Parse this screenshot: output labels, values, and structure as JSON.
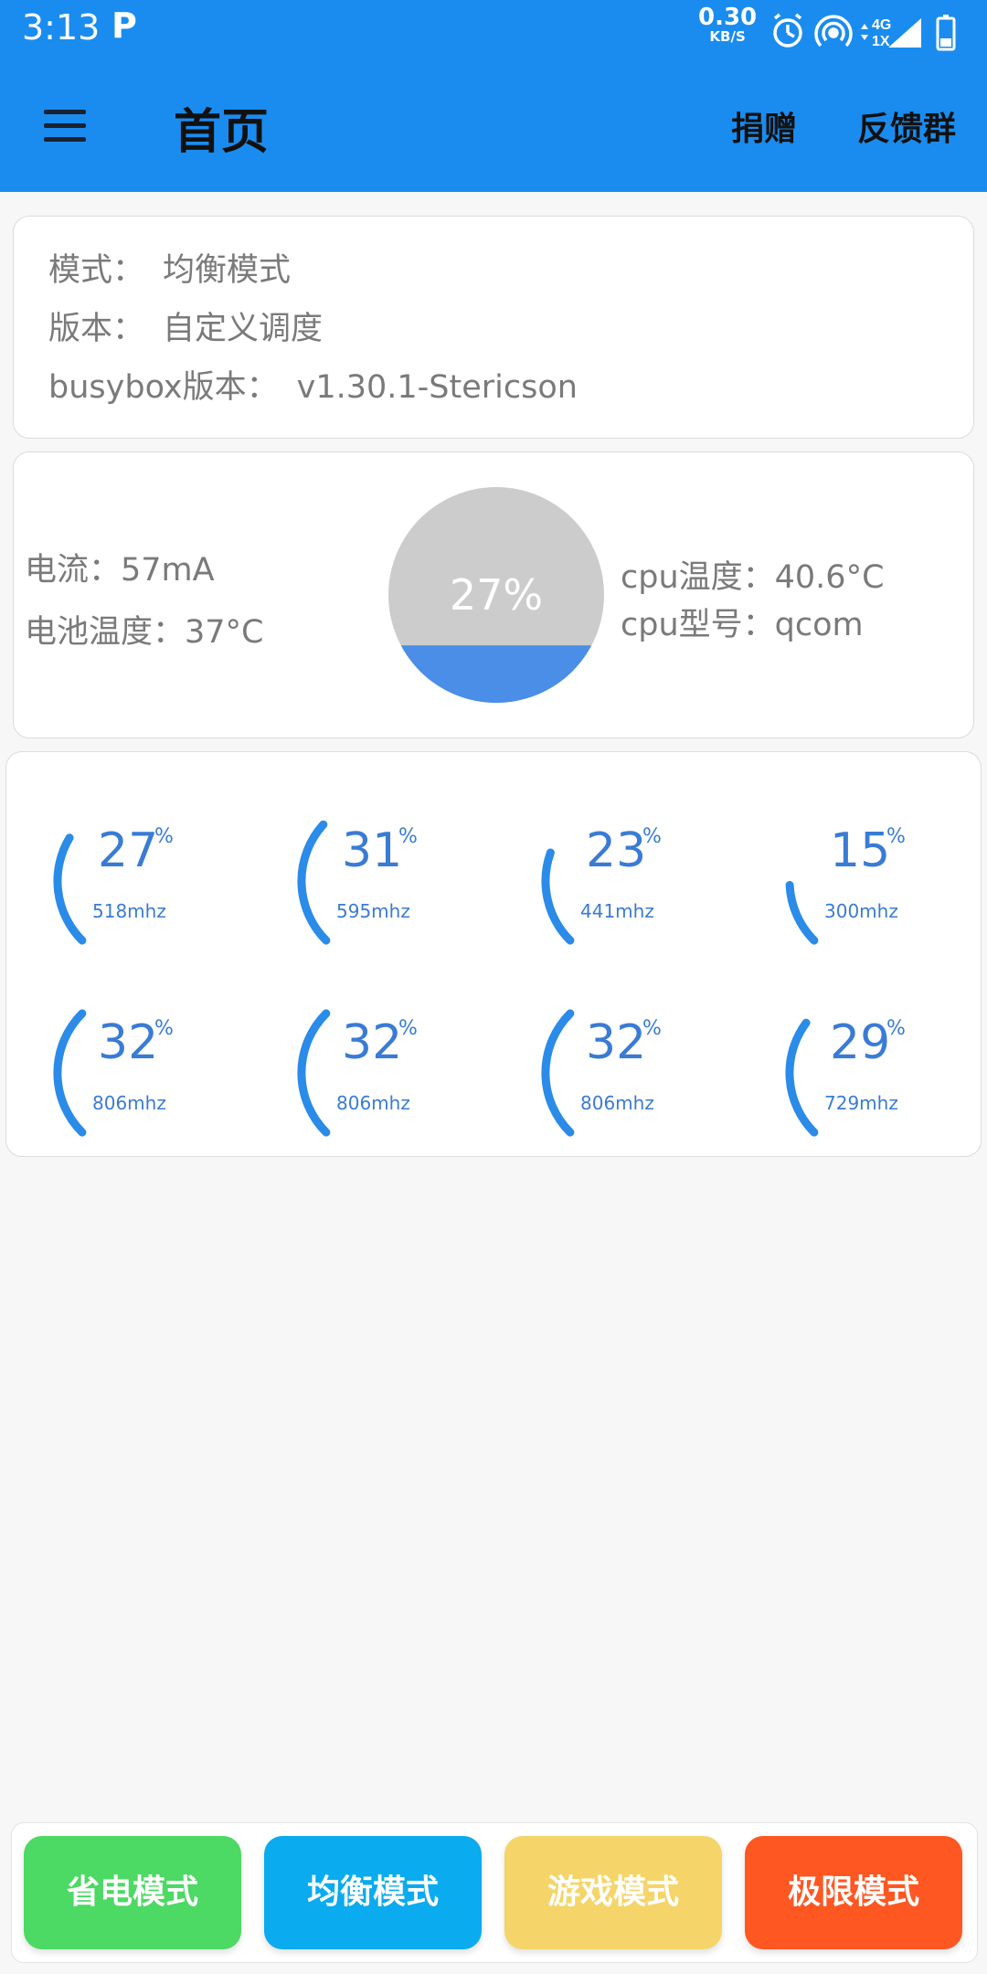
{
  "status_bar": {
    "time": "3:13",
    "notification_letter": "P",
    "net_speed_value": "0.30",
    "net_speed_unit": "KB/S",
    "network_label_top": "4G",
    "network_label_bottom": "1X",
    "icons": [
      "alarm-icon",
      "hotspot-icon",
      "signal-icon",
      "battery-icon"
    ]
  },
  "app_bar": {
    "title": "首页",
    "actions": [
      "捐赠",
      "反馈群"
    ]
  },
  "info_card": {
    "mode_label": "模式：",
    "mode_value": "均衡模式",
    "version_label": "版本：",
    "version_value": "自定义调度",
    "busybox_label": "busybox版本：",
    "busybox_value": "v1.30.1-Stericson"
  },
  "status_card": {
    "current": "电流：57mA",
    "battery_temp": "电池温度：37°C",
    "battery_percent": "27%",
    "battery_level": 0.27,
    "cpu_temp": "cpu温度：40.6°C",
    "cpu_model": "cpu型号：qcom"
  },
  "cores": [
    {
      "load": "27",
      "freq": "518mhz",
      "level": 0.27
    },
    {
      "load": "31",
      "freq": "595mhz",
      "level": 0.31
    },
    {
      "load": "23",
      "freq": "441mhz",
      "level": 0.23
    },
    {
      "load": "15",
      "freq": "300mhz",
      "level": 0.15
    },
    {
      "load": "32",
      "freq": "806mhz",
      "level": 0.32
    },
    {
      "load": "32",
      "freq": "806mhz",
      "level": 0.32
    },
    {
      "load": "32",
      "freq": "806mhz",
      "level": 0.32
    },
    {
      "load": "29",
      "freq": "729mhz",
      "level": 0.29
    }
  ],
  "percent_symbol": "%",
  "modes": [
    {
      "label": "省电模式",
      "color": "#4cd964"
    },
    {
      "label": "均衡模式",
      "color": "#0aabef"
    },
    {
      "label": "游戏模式",
      "color": "#f5d56a"
    },
    {
      "label": "极限模式",
      "color": "#ff5722"
    }
  ],
  "colors": {
    "primary": "#1a8cef",
    "gauge_blue": "#2b8be8",
    "battery_empty": "#cccccc",
    "battery_fill": "#4a8ee8"
  }
}
